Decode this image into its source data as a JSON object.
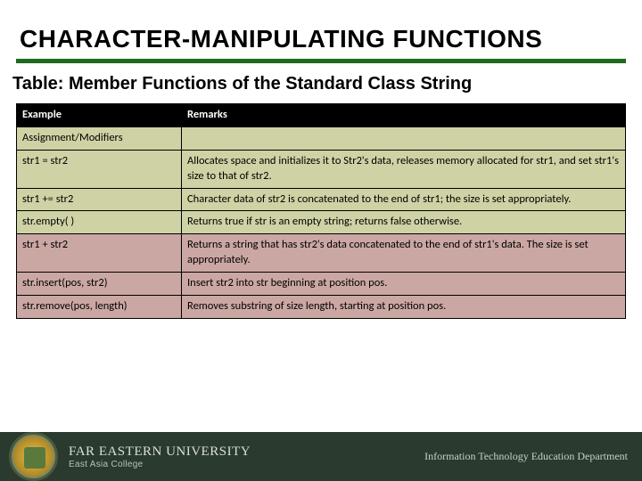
{
  "title": "CHARACTER-MANIPULATING FUNCTIONS",
  "subtitle": "Table: Member Functions of the Standard Class String",
  "headers": {
    "example": "Example",
    "remarks": "Remarks"
  },
  "rows": [
    {
      "ex": "Assignment/Modifiers",
      "rem": ""
    },
    {
      "ex": "str1 = str2",
      "rem": "Allocates space and initializes it to Str2's data, releases memory allocated for str1, and set str1's size to that of str2."
    },
    {
      "ex": "str1 += str2",
      "rem": "Character data of str2 is concatenated to the end of str1; the size is set appropriately."
    },
    {
      "ex": "str.empty( )",
      "rem": "Returns true if str is an empty string; returns false otherwise."
    },
    {
      "ex": "str1 + str2",
      "rem": "Returns a string that has str2's data concatenated to the end of str1's data. The size is set appropriately."
    },
    {
      "ex": "str.insert(pos, str2)",
      "rem": "Insert str2 into str beginning at position pos."
    },
    {
      "ex": "str.remove(pos, length)",
      "rem": "Removes substring of size length, starting at position pos."
    }
  ],
  "footer": {
    "university": "FAR EASTERN UNIVERSITY",
    "college": "East Asia College",
    "department": "Information Technology Education Department"
  }
}
